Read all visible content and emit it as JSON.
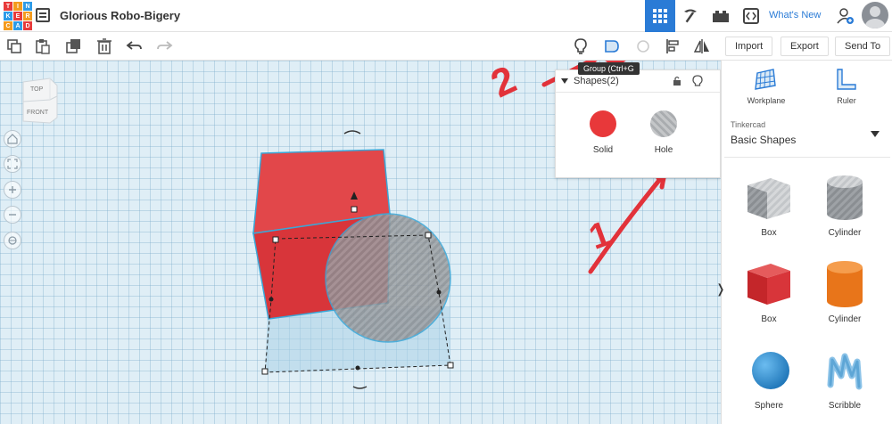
{
  "app": {
    "logo_letters": [
      "T",
      "I",
      "N",
      "K",
      "E",
      "R",
      "C",
      "A",
      "D"
    ],
    "logo_colors": [
      "#e83a3a",
      "#f49b1e",
      "#2d9be8",
      "#2d9be8",
      "#e83a3a",
      "#f49b1e",
      "#f49b1e",
      "#2d9be8",
      "#e83a3a"
    ],
    "project_title": "Glorious Robo-Bigery",
    "whats_new": "What's New"
  },
  "toolbar": {
    "import": "Import",
    "export": "Export",
    "send_to": "Send To",
    "tooltip": "Group (Ctrl+G"
  },
  "viewcube": {
    "top": "TOP",
    "front": "FRONT"
  },
  "inspector": {
    "title": "Shapes(2)",
    "solid_label": "Solid",
    "hole_label": "Hole",
    "solid_color": "#e8383a",
    "hole_color": "#b9b9b9"
  },
  "sidepanel": {
    "workplane": "Workplane",
    "ruler": "Ruler",
    "library_source": "Tinkercad",
    "library_selected": "Basic Shapes",
    "shapes": [
      {
        "label": "Box",
        "kind": "box-hole"
      },
      {
        "label": "Cylinder",
        "kind": "cylinder-hole"
      },
      {
        "label": "Box",
        "kind": "box-red"
      },
      {
        "label": "Cylinder",
        "kind": "cylinder-orange"
      },
      {
        "label": "Sphere",
        "kind": "sphere-blue"
      },
      {
        "label": "Scribble",
        "kind": "scribble-blue"
      }
    ]
  },
  "annotations": {
    "color": "#e2323a",
    "step1": "1",
    "step2": "2"
  }
}
